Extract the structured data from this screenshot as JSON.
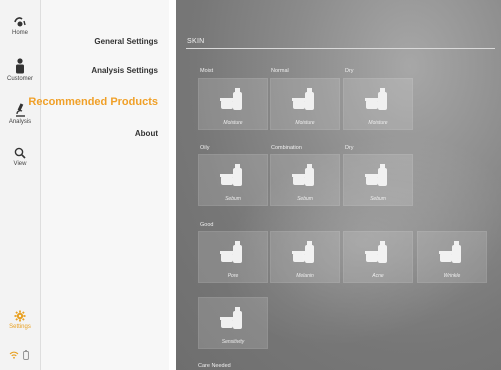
{
  "rail": {
    "home_label": "Home",
    "customer_label": "Customer",
    "analysis_label": "Analysis",
    "view_label": "View",
    "settings_label": "Settings"
  },
  "menu": {
    "general_settings": "General Settings",
    "analysis_settings": "Analysis Settings",
    "recommended_products": "Recommended Products",
    "about": "About"
  },
  "content": {
    "section_title": "SKIN",
    "moisture_row": {
      "labels": [
        "Moist",
        "Normal",
        "Dry"
      ],
      "tile_names": [
        "Moisture",
        "Moisture",
        "Moisture"
      ]
    },
    "oil_row": {
      "labels": [
        "Oily",
        "Combination",
        "Dry"
      ],
      "tile_names": [
        "Sebum",
        "Sebum",
        "Sebum"
      ]
    },
    "good_row": {
      "label": "Good",
      "tile_names": [
        "Pore",
        "Melanin",
        "Acne",
        "Wrinkle"
      ]
    },
    "good_row2": {
      "tile_names": [
        "Sensitivity"
      ]
    },
    "care_needed_label": "Care Needed"
  },
  "colors": {
    "accent": "#f0a028",
    "rail_bg": "#f3f3f3",
    "menu_bg": "#f7f7f7"
  }
}
